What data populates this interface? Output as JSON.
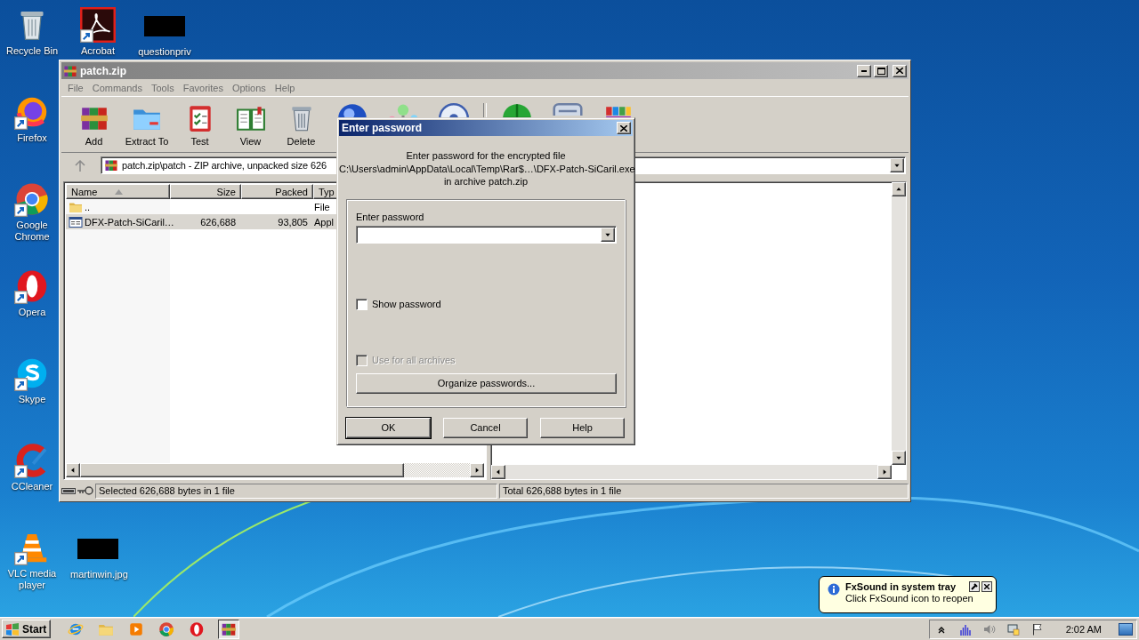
{
  "desktop": {
    "icon_rows": [
      [
        {
          "kind": "recycle",
          "label": "Recycle Bin",
          "shortcut": false
        },
        {
          "kind": "acrobat",
          "label": "Acrobat",
          "shortcut": true
        },
        {
          "kind": "redacted",
          "label": "questionpriv",
          "shortcut": false
        }
      ],
      [
        {
          "kind": "firefox",
          "label": "Firefox",
          "shortcut": true
        }
      ],
      [
        {
          "kind": "chrome",
          "label": "Google Chrome",
          "shortcut": true
        }
      ],
      [
        {
          "kind": "opera",
          "label": "Opera",
          "shortcut": true
        }
      ],
      [
        {
          "kind": "skype",
          "label": "Skype",
          "shortcut": true
        }
      ],
      [
        {
          "kind": "ccleaner",
          "label": "CCleaner",
          "shortcut": true
        }
      ],
      [
        {
          "kind": "vlc",
          "label": "VLC media player",
          "shortcut": true
        },
        {
          "kind": "redacted",
          "label": "martinwin.jpg",
          "shortcut": false
        }
      ]
    ]
  },
  "archive_window": {
    "title": "patch.zip",
    "active": false,
    "menu": [
      "File",
      "Commands",
      "Tools",
      "Favorites",
      "Options",
      "Help"
    ],
    "toolbar_groups": [
      [
        {
          "kind": "add",
          "label": "Add"
        },
        {
          "kind": "extract",
          "label": "Extract To"
        },
        {
          "kind": "test",
          "label": "Test"
        },
        {
          "kind": "view",
          "label": "View"
        },
        {
          "kind": "delete",
          "label": "Delete"
        },
        {
          "kind": "find"
        },
        {
          "kind": "wizard"
        },
        {
          "kind": "info"
        }
      ],
      [
        {
          "kind": "virusscan"
        },
        {
          "kind": "comment"
        },
        {
          "kind": "sfx"
        }
      ]
    ],
    "path": "patch.zip\\patch - ZIP archive, unpacked size 626",
    "columns": [
      {
        "label": "Name",
        "sorted": true
      },
      {
        "label": "Size"
      },
      {
        "label": "Packed"
      },
      {
        "label": "Typ"
      }
    ],
    "rows": [
      {
        "kind": "folder",
        "name": "..",
        "type": "File",
        "selected": false
      },
      {
        "kind": "program",
        "name": "DFX-Patch-SiCaril…",
        "size": "626,688",
        "packed": "93,805",
        "type": "Appl",
        "selected": true
      }
    ],
    "status_selected": "Selected 626,688 bytes in 1 file",
    "status_total": "Total 626,688 bytes in 1 file"
  },
  "password_dialog": {
    "title": "Enter password",
    "active": true,
    "message_lines": [
      "Enter password for the encrypted file",
      "C:\\Users\\admin\\AppData\\Local\\Temp\\Rar$…\\DFX-Patch-SiCaril.exe",
      "in archive patch.zip"
    ],
    "password_label": "Enter password",
    "options": [
      {
        "label": "Show password",
        "checked": false,
        "disabled": false
      },
      {
        "label": "Use for all archives",
        "checked": false,
        "disabled": true
      }
    ],
    "organize_button": "Organize passwords...",
    "buttons": [
      {
        "label": "OK",
        "default": true
      },
      {
        "label": "Cancel",
        "default": false
      },
      {
        "label": "Help",
        "default": false
      }
    ]
  },
  "balloon": {
    "title": "FxSound in system tray",
    "text": "Click FxSound icon to reopen"
  },
  "taskbar": {
    "start": "Start",
    "apps": [
      {
        "kind": "ie",
        "active": false
      },
      {
        "kind": "explorer",
        "active": false
      },
      {
        "kind": "mediaplayer",
        "active": false
      },
      {
        "kind": "chrome",
        "active": false
      },
      {
        "kind": "opera",
        "active": false
      },
      {
        "kind": "winrar",
        "active": true
      }
    ],
    "tray_icons": [
      {
        "kind": "expand"
      },
      {
        "kind": "fxsound"
      },
      {
        "kind": "volume"
      },
      {
        "kind": "network"
      },
      {
        "kind": "flag"
      }
    ],
    "clock": "2:02 AM"
  }
}
